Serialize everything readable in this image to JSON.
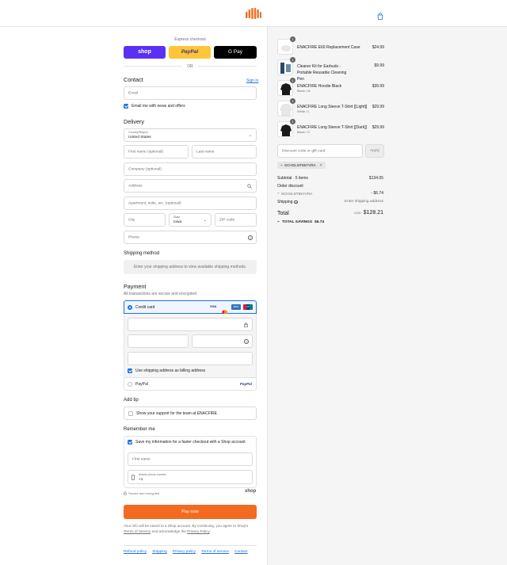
{
  "express": {
    "label": "Express checkout",
    "shop": "shop",
    "paypal": "PayPal",
    "gpay": "G Pay",
    "or": "OR"
  },
  "contact": {
    "title": "Contact",
    "signin": "Sign in",
    "email_ph": "Email",
    "newsletter": "Email me with news and offers"
  },
  "delivery": {
    "title": "Delivery",
    "country_label": "Country/Region",
    "country_value": "United States",
    "first_ph": "First name (optional)",
    "last_ph": "Last name",
    "company_ph": "Company (optional)",
    "address_ph": "Address",
    "apt_ph": "Apartment, suite, etc. (optional)",
    "city_ph": "City",
    "state_label": "State",
    "state_value": "Iowa",
    "zip_ph": "ZIP code",
    "phone_ph": "Phone"
  },
  "shipping": {
    "title": "Shipping method",
    "notice": "Enter your shipping address to view available shipping methods."
  },
  "payment": {
    "title": "Payment",
    "subtitle": "All transactions are secure and encrypted.",
    "cc_label": "Credit card",
    "card_brands": [
      "VISA",
      "MC",
      "AMEX",
      "UP"
    ],
    "billing_same": "Use shipping address as billing address",
    "paypal_label": "PayPal",
    "paypal_logo": "PayPal"
  },
  "tip": {
    "title": "Add tip",
    "option": "Show your support for the team at ENACFIRE"
  },
  "remember": {
    "title": "Remember me",
    "save_info": "Save my information for a faster checkout with a Shop account",
    "first_ph": "First name",
    "mobile_label": "Mobile phone number",
    "mobile_value": "+1",
    "secure": "Secure and encrypted",
    "shop_logo": "shop"
  },
  "pay": {
    "button": "Pay now",
    "legal_pre": "Your info will be saved to a Shop account. By continuing, you agree to Shop's",
    "tos": "Terms of Service",
    "legal_mid": "and acknowledge the",
    "privacy": "Privacy Policy",
    "legal_end": "."
  },
  "footer": [
    "Refund policy",
    "Shipping",
    "Privacy policy",
    "Terms of service",
    "Contact"
  ],
  "cart": {
    "items": [
      {
        "name": "ENACFIRE E60 Replacement Case",
        "variant": "",
        "qty": "1",
        "price": "$24.99"
      },
      {
        "name": "Cleaner Kit for Earbuds - Portable Reusable Cleaning Pen",
        "variant": "",
        "qty": "1",
        "price": "$9.99"
      },
      {
        "name": "ENACFIRE Hoodie Black",
        "variant": "Black / M",
        "qty": "1",
        "price": "$39.99"
      },
      {
        "name": "ENACFIRE Long Sleeve T-Shirt [[Light]]",
        "variant": "White / L",
        "qty": "1",
        "price": "$29.99"
      },
      {
        "name": "ENACFIRE Long Sleeve T-Shirt [[Dark]]",
        "variant": "Black / S",
        "qty": "1",
        "price": "$29.99"
      }
    ],
    "discount_ph": "Discount code or gift card",
    "apply": "Apply",
    "code": "SCHGLNT55YVRA",
    "subtotal_label": "Subtotal · 5 items",
    "subtotal": "$134.95",
    "order_discount_label": "Order discount",
    "order_discount_code": "SCHGLNT55YVRA",
    "order_discount": "- $6.74",
    "shipping_label": "Shipping",
    "shipping_value": "Enter shipping address",
    "total_label": "Total",
    "currency": "USD",
    "total": "$128.21",
    "savings_label": "TOTAL SAVINGS",
    "savings": "$6.74"
  },
  "colors": {
    "accent": "#1a73e8",
    "pay": "#f26b21",
    "logo": "#f26b21",
    "shop": "#5a31f4",
    "paypal": "#ffc439"
  }
}
